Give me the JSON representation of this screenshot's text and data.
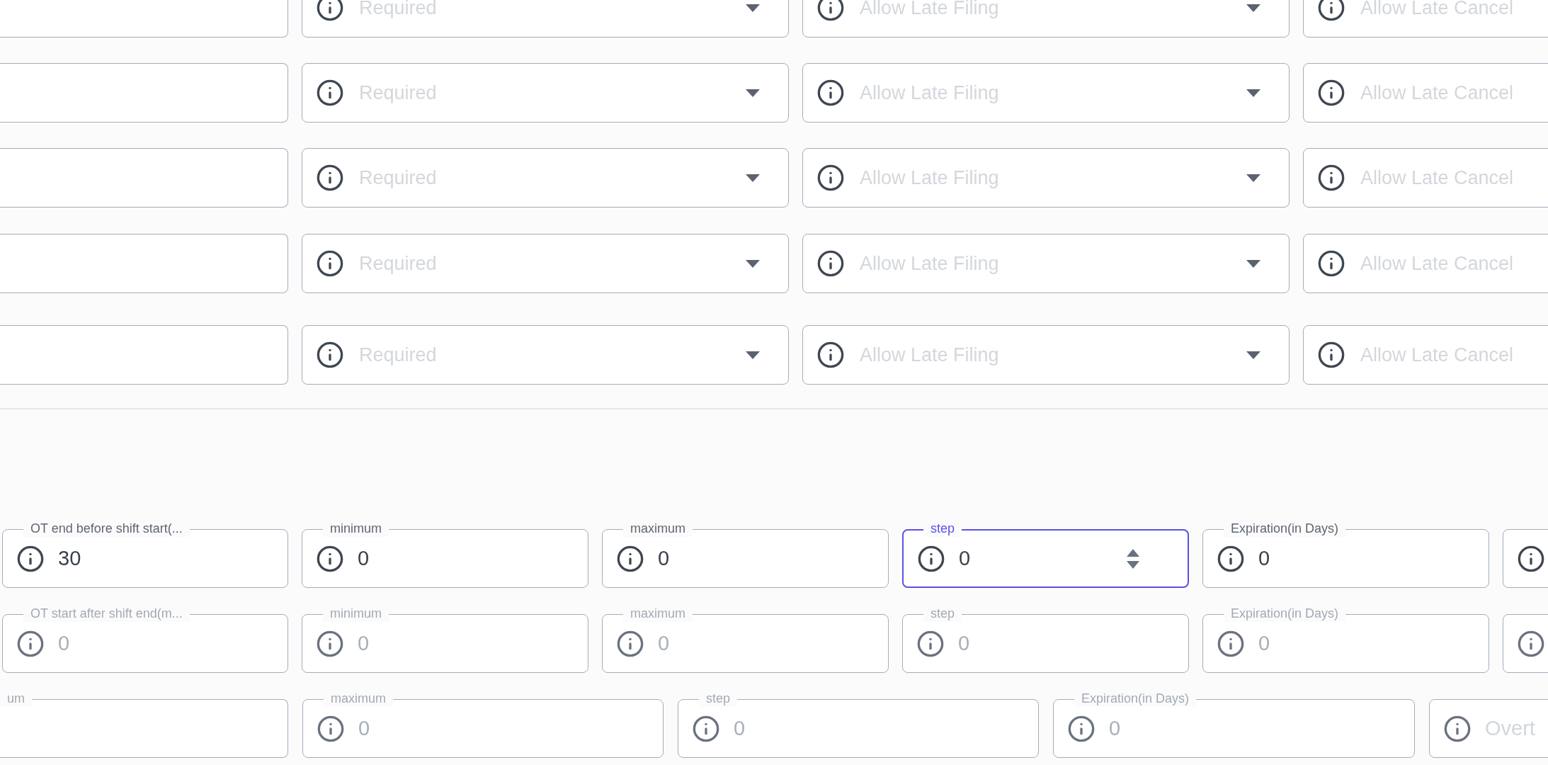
{
  "select_rows": [
    {
      "fields": [
        {
          "kind": "edge"
        },
        {
          "kind": "select",
          "placeholder": "Required"
        },
        {
          "kind": "select",
          "placeholder": "Allow Late Filing"
        },
        {
          "kind": "input",
          "placeholder": "Allow Late Cancel"
        }
      ]
    },
    {
      "fields": [
        {
          "kind": "edge"
        },
        {
          "kind": "select",
          "placeholder": "Required"
        },
        {
          "kind": "select",
          "placeholder": "Allow Late Filing"
        },
        {
          "kind": "input",
          "placeholder": "Allow Late Cancel"
        }
      ]
    },
    {
      "fields": [
        {
          "kind": "edge"
        },
        {
          "kind": "select",
          "placeholder": "Required"
        },
        {
          "kind": "select",
          "placeholder": "Allow Late Filing"
        },
        {
          "kind": "input",
          "placeholder": "Allow Late Cancel"
        }
      ]
    },
    {
      "fields": [
        {
          "kind": "edge"
        },
        {
          "kind": "select",
          "placeholder": "Required"
        },
        {
          "kind": "select",
          "placeholder": "Allow Late Filing"
        },
        {
          "kind": "input",
          "placeholder": "Allow Late Cancel"
        }
      ]
    },
    {
      "fields": [
        {
          "kind": "edge"
        },
        {
          "kind": "select",
          "placeholder": "Required"
        },
        {
          "kind": "select",
          "placeholder": "Allow Late Filing"
        },
        {
          "kind": "input",
          "placeholder": "Allow Late Cancel"
        }
      ]
    }
  ],
  "number_rows": [
    {
      "fields": [
        {
          "kind": "number",
          "label": "OT end before shift start(...",
          "value": "30",
          "disabled": false,
          "focused": false
        },
        {
          "kind": "number",
          "label": "minimum",
          "value": "0",
          "disabled": false,
          "focused": false
        },
        {
          "kind": "number",
          "label": "maximum",
          "value": "0",
          "disabled": false,
          "focused": false
        },
        {
          "kind": "number",
          "label": "step",
          "value": "0",
          "disabled": false,
          "focused": true
        },
        {
          "kind": "number",
          "label": "Expiration(in Days)",
          "value": "0",
          "disabled": false,
          "focused": false
        },
        {
          "kind": "number",
          "disabled": false,
          "focused": false
        }
      ]
    },
    {
      "fields": [
        {
          "kind": "number",
          "label": "OT start after shift end(m...",
          "value": "0",
          "disabled": true,
          "focused": false
        },
        {
          "kind": "number",
          "label": "minimum",
          "value": "0",
          "disabled": true,
          "focused": false
        },
        {
          "kind": "number",
          "label": "maximum",
          "value": "0",
          "disabled": true,
          "focused": false
        },
        {
          "kind": "number",
          "label": "step",
          "value": "0",
          "disabled": true,
          "focused": false
        },
        {
          "kind": "number",
          "label": "Expiration(in Days)",
          "value": "0",
          "disabled": true,
          "focused": false
        },
        {
          "kind": "number",
          "disabled": true,
          "focused": false
        }
      ]
    },
    {
      "fields": [
        {
          "kind": "edge",
          "label": "um",
          "disabled": true,
          "focused": false
        },
        {
          "kind": "number",
          "label": "maximum",
          "value": "0",
          "disabled": true,
          "focused": false
        },
        {
          "kind": "number",
          "label": "step",
          "value": "0",
          "disabled": true,
          "focused": false
        },
        {
          "kind": "number",
          "label": "Expiration(in Days)",
          "value": "0",
          "disabled": true,
          "focused": false
        },
        {
          "kind": "number",
          "placeholder": "Overt",
          "disabled": true,
          "focused": false
        }
      ]
    }
  ]
}
